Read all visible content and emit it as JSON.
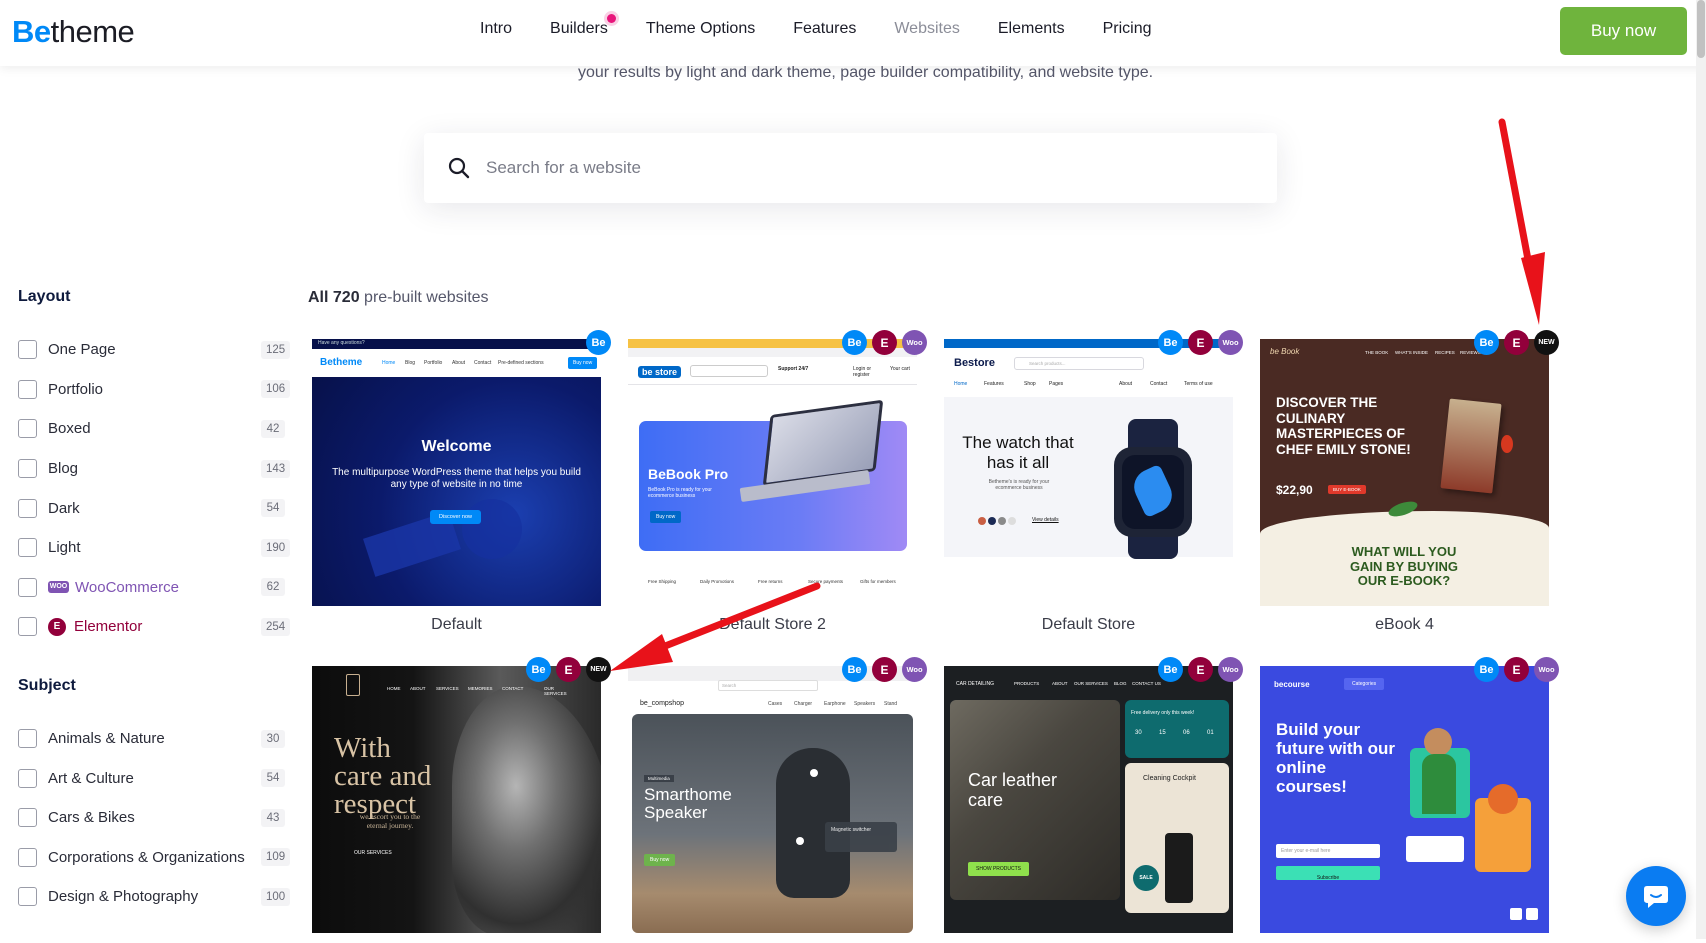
{
  "brand": {
    "logo_be": "Be",
    "logo_theme": "theme"
  },
  "nav": {
    "items": [
      "Intro",
      "Builders",
      "Theme Options",
      "Features",
      "Websites",
      "Elements",
      "Pricing"
    ],
    "active": "Websites",
    "buy_label": "Buy now"
  },
  "intro": {
    "text": "your results by light and dark theme, page builder compatibility, and website type."
  },
  "search": {
    "placeholder": "Search for a website"
  },
  "layout": {
    "title": "Layout",
    "items": [
      {
        "label": "One Page",
        "count": "125"
      },
      {
        "label": "Portfolio",
        "count": "106"
      },
      {
        "label": "Boxed",
        "count": "42"
      },
      {
        "label": "Blog",
        "count": "143"
      },
      {
        "label": "Dark",
        "count": "54"
      },
      {
        "label": "Light",
        "count": "190"
      },
      {
        "label": "WooCommerce",
        "count": "62",
        "icon": "woo"
      },
      {
        "label": "Elementor",
        "count": "254",
        "icon": "elementor"
      }
    ]
  },
  "subject": {
    "title": "Subject",
    "items": [
      {
        "label": "Animals & Nature",
        "count": "30"
      },
      {
        "label": "Art & Culture",
        "count": "54"
      },
      {
        "label": "Cars & Bikes",
        "count": "43"
      },
      {
        "label": "Corporations & Organizations",
        "count": "109"
      },
      {
        "label": "Design & Photography",
        "count": "100"
      }
    ]
  },
  "results": {
    "all": "All 720",
    "rest": "pre-built websites"
  },
  "badges": {
    "be": "Be",
    "elementor": "E",
    "woo": "Woo",
    "new": "NEW"
  },
  "cards": [
    {
      "name": "Default",
      "badges": [
        "be"
      ]
    },
    {
      "name": "Default Store 2",
      "badges": [
        "be",
        "elementor",
        "woo"
      ]
    },
    {
      "name": "Default Store",
      "badges": [
        "be",
        "elementor",
        "woo"
      ]
    },
    {
      "name": "eBook 4",
      "badges": [
        "be",
        "elementor",
        "new"
      ]
    },
    {
      "name": "",
      "badges": [
        "be",
        "elementor",
        "new"
      ]
    },
    {
      "name": "",
      "badges": [
        "be",
        "elementor",
        "woo"
      ]
    },
    {
      "name": "",
      "badges": [
        "be",
        "elementor",
        "woo"
      ]
    },
    {
      "name": "",
      "badges": [
        "be",
        "elementor",
        "woo"
      ]
    }
  ],
  "thumbs": {
    "t1": {
      "logo": "Betheme",
      "title": "Welcome",
      "sub": "The multipurpose WordPress theme that helps you build any type of website in no time",
      "btn": "Discover now",
      "nav": [
        "Home",
        "Blog",
        "Portfolio",
        "About",
        "Contact",
        "Pre-defined sections"
      ],
      "top": "Have any questions?",
      "buy": "Buy now"
    },
    "t2": {
      "logo": "be store",
      "title": "BeBook Pro",
      "sub": "BeBook Pro is ready for your ecommerce business",
      "btn": "Buy now",
      "support": "Support 24/7",
      "login": "Login or register",
      "cart": "Your cart",
      "feats": [
        "Free Shipping",
        "Daily Promotions",
        "Free returns",
        "Secure payments",
        "Gifts for members"
      ]
    },
    "t3": {
      "logo": "Bestore",
      "title": "The watch that has it all",
      "sub": "Betheme's is ready for your ecommerce business",
      "link": "View details",
      "search": "Search products...",
      "nav": [
        "Home",
        "Features",
        "Shop",
        "Pages",
        "About",
        "Contact",
        "Terms of use"
      ]
    },
    "t4": {
      "logo": "be Book",
      "title": "DISCOVER THE CULINARY MASTERPIECES OF CHEF EMILY STONE!",
      "price": "$22,90",
      "btn": "BUY E-BOOK",
      "bottom": "WHAT WILL YOU GAIN BY BUYING OUR E-BOOK?",
      "nav": [
        "THE BOOK",
        "WHAT'S INSIDE",
        "RECIPES",
        "REVIEWS"
      ]
    },
    "t5": {
      "title": "With care and respect",
      "sub": "we escort you to the eternal journey.",
      "btn": "OUR SERVICES",
      "nav": [
        "HOME",
        "ABOUT",
        "SERVICES",
        "MEMORIES",
        "CONTACT",
        "OUR SERVICES"
      ]
    },
    "t6": {
      "logo": "be_compshop",
      "label": "Smarthome Speaker",
      "chip": "Magnetic switcher",
      "btn": "Buy now",
      "tag": "Multimedia",
      "nav": [
        "Cases",
        "Charger",
        "Earphone",
        "Speakers",
        "Stand"
      ],
      "search": "Search"
    },
    "t7": {
      "title": "Car leather care",
      "btn": "SHOW PRODUCTS",
      "card": "Cleaning Cockpit",
      "sale": "SALE",
      "promo": "Free delivery only this week!",
      "nav": [
        "PRODUCTS",
        "ABOUT",
        "OUR SERVICES",
        "BLOG",
        "CONTACT US"
      ],
      "logo": "CAR DETAILING",
      "timer": [
        "30",
        "15",
        "06",
        "01"
      ]
    },
    "t8": {
      "logo": "becourse",
      "title": "Build your future with our online courses!",
      "btn": "Subscribe",
      "input": "Enter your e-mail here",
      "cat": "Categories"
    }
  },
  "colors": {
    "accent": "#0089f7",
    "buy": "#6fb43d",
    "woo": "#7f54b3",
    "elementor": "#92003b",
    "arrow": "#e8121a"
  }
}
